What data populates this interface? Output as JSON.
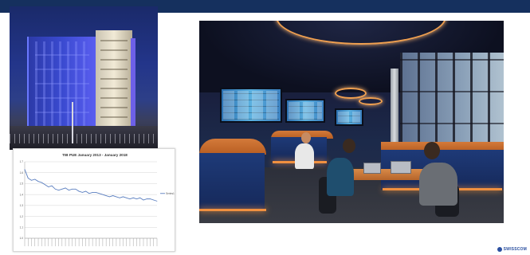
{
  "slide": {
    "logo_text": "SWISSCOM"
  },
  "chart_data": {
    "type": "line",
    "title": "TIB PUE January 2013 - January 2018",
    "legend": [
      "Series1"
    ],
    "legend_position": "right",
    "grid": true,
    "yticks": [
      "1.7",
      "1.6",
      "1.5",
      "1.4",
      "1.3",
      "1.2",
      "1.1",
      "1.0"
    ],
    "ylim": [
      1.0,
      1.7
    ],
    "series": [
      {
        "name": "Series1",
        "values": [
          1.63,
          1.55,
          1.53,
          1.54,
          1.52,
          1.51,
          1.49,
          1.47,
          1.48,
          1.45,
          1.44,
          1.45,
          1.46,
          1.44,
          1.45,
          1.45,
          1.43,
          1.42,
          1.43,
          1.41,
          1.42,
          1.42,
          1.41,
          1.4,
          1.39,
          1.38,
          1.39,
          1.38,
          1.37,
          1.38,
          1.37,
          1.36,
          1.37,
          1.36,
          1.37,
          1.35,
          1.36,
          1.36,
          1.35,
          1.34
        ]
      }
    ],
    "colors": {
      "line": "#5b7fc0",
      "grid": "#d4d4d4",
      "axis": "#999999"
    }
  },
  "colors": {
    "top_bar": "#15305e",
    "desk_glow": "#f09040",
    "ceiling_rings": "#f0a050"
  }
}
